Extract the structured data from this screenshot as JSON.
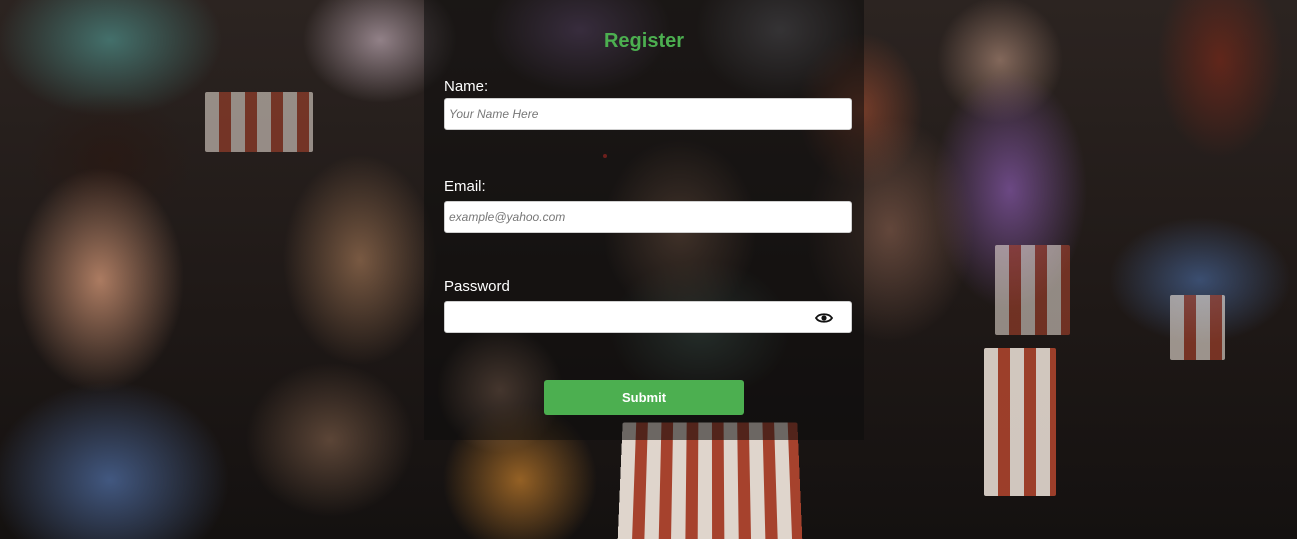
{
  "form": {
    "title": "Register",
    "name_label": "Name:",
    "name_placeholder": "Your Name Here",
    "name_value": "",
    "email_label": "Email:",
    "email_placeholder": "example@yahoo.com",
    "email_value": "",
    "password_label": "Password",
    "password_value": "",
    "password_toggle_icon": "eye-icon",
    "submit_label": "Submit"
  },
  "colors": {
    "accent": "#4caf50",
    "label_text": "#ffffff",
    "panel_overlay": "rgba(12,12,12,0.55)"
  }
}
